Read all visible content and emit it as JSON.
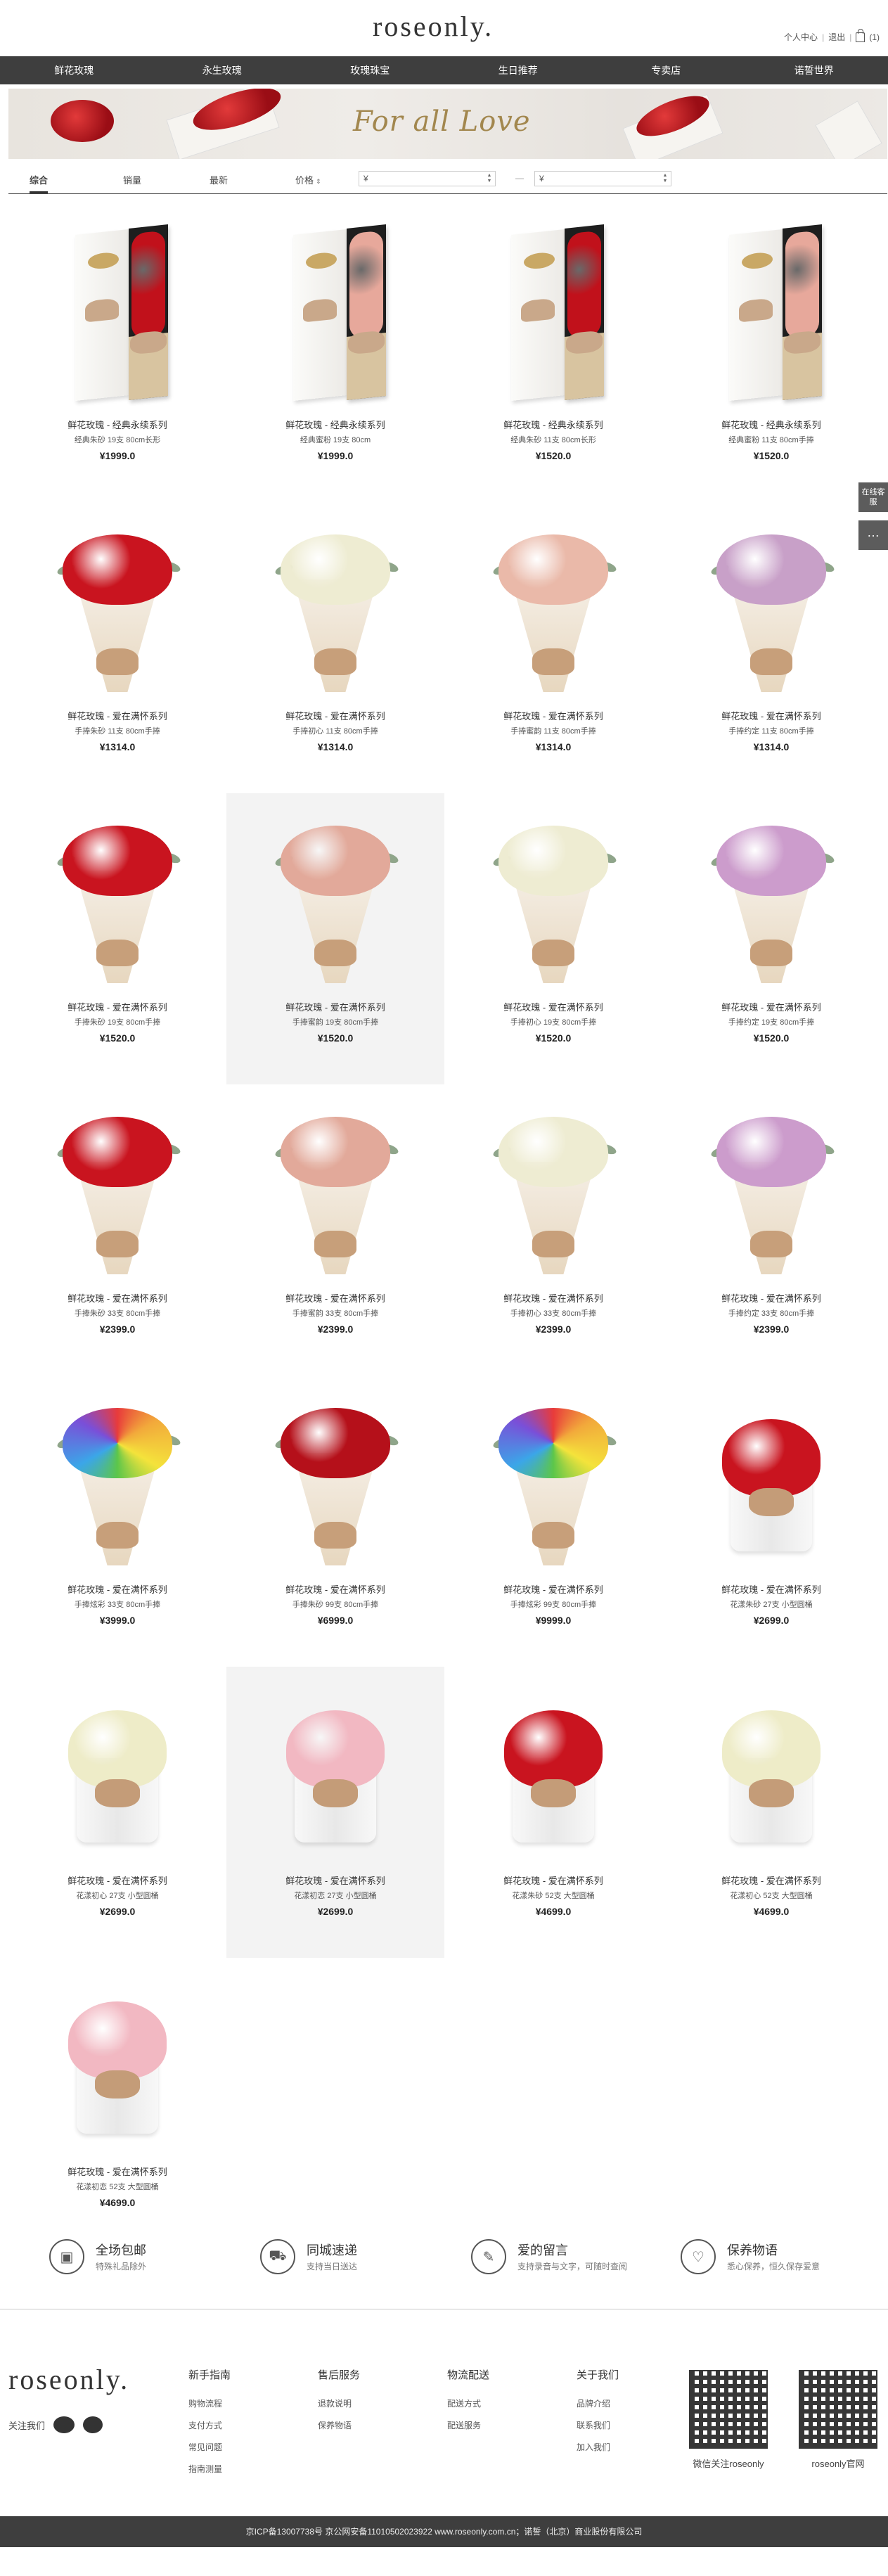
{
  "header": {
    "logo": "roseonly.",
    "user_center": "个人中心",
    "logout": "退出",
    "cart_count": "(1)"
  },
  "nav": [
    {
      "label": "鲜花玫瑰"
    },
    {
      "label": "永生玫瑰"
    },
    {
      "label": "玫瑰珠宝"
    },
    {
      "label": "生日推荐"
    },
    {
      "label": "专卖店"
    },
    {
      "label": "诺誓世界"
    }
  ],
  "banner": {
    "text": "For all Love"
  },
  "sort": {
    "default": "综合",
    "sales": "销量",
    "newest": "最新",
    "price": "价格",
    "price_from": "¥",
    "price_to": "¥",
    "dash": "—"
  },
  "products": [
    {
      "title": "鲜花玫瑰 - 经典永续系列",
      "sub": "经典朱砂 19支 80cm长形",
      "price": "¥1999.0",
      "type": "giftbox",
      "rose_color": "#c1111b"
    },
    {
      "title": "鲜花玫瑰 - 经典永续系列",
      "sub": "经典蜜粉 19支 80cm",
      "price": "¥1999.0",
      "type": "giftbox",
      "rose_color": "#e7a89b"
    },
    {
      "title": "鲜花玫瑰 - 经典永续系列",
      "sub": "经典朱砂 11支 80cm长形",
      "price": "¥1520.0",
      "type": "giftbox",
      "rose_color": "#c1111b"
    },
    {
      "title": "鲜花玫瑰 - 经典永续系列",
      "sub": "经典蜜粉 11支 80cm手捧",
      "price": "¥1520.0",
      "type": "giftbox",
      "rose_color": "#e7a89b"
    },
    {
      "title": "鲜花玫瑰 - 爱在满怀系列",
      "sub": "手捧朱砂 11支 80cm手捧",
      "price": "¥1314.0",
      "type": "bouquet",
      "rose_color": "#c9141f"
    },
    {
      "title": "鲜花玫瑰 - 爱在满怀系列",
      "sub": "手捧初心 11支 80cm手捧",
      "price": "¥1314.0",
      "type": "bouquet",
      "rose_color": "#eeecd2"
    },
    {
      "title": "鲜花玫瑰 - 爱在满怀系列",
      "sub": "手捧蜜韵 11支 80cm手捧",
      "price": "¥1314.0",
      "type": "bouquet",
      "rose_color": "#eab9a9"
    },
    {
      "title": "鲜花玫瑰 - 爱在满怀系列",
      "sub": "手捧约定 11支 80cm手捧",
      "price": "¥1314.0",
      "type": "bouquet",
      "rose_color": "#c8a0c8"
    },
    {
      "title": "鲜花玫瑰 - 爱在满怀系列",
      "sub": "手捧朱砂 19支 80cm手捧",
      "price": "¥1520.0",
      "type": "bouquet",
      "rose_color": "#c9141f"
    },
    {
      "title": "鲜花玫瑰 - 爱在满怀系列",
      "sub": "手捧蜜韵 19支 80cm手捧",
      "price": "¥1520.0",
      "type": "bouquet",
      "rose_color": "#e2a99a"
    },
    {
      "title": "鲜花玫瑰 - 爱在满怀系列",
      "sub": "手捧初心 19支 80cm手捧",
      "price": "¥1520.0",
      "type": "bouquet",
      "rose_color": "#eeecd2"
    },
    {
      "title": "鲜花玫瑰 - 爱在满怀系列",
      "sub": "手捧约定 19支 80cm手捧",
      "price": "¥1520.0",
      "type": "bouquet",
      "rose_color": "#cc9ccc"
    },
    {
      "title": "鲜花玫瑰 - 爱在满怀系列",
      "sub": "手捧朱砂 33支 80cm手捧",
      "price": "¥2399.0",
      "type": "bouquet",
      "rose_color": "#c9141f"
    },
    {
      "title": "鲜花玫瑰 - 爱在满怀系列",
      "sub": "手捧蜜韵 33支 80cm手捧",
      "price": "¥2399.0",
      "type": "bouquet",
      "rose_color": "#e2a99a"
    },
    {
      "title": "鲜花玫瑰 - 爱在满怀系列",
      "sub": "手捧初心 33支 80cm手捧",
      "price": "¥2399.0",
      "type": "bouquet",
      "rose_color": "#eeecd2"
    },
    {
      "title": "鲜花玫瑰 - 爱在满怀系列",
      "sub": "手捧约定 33支 80cm手捧",
      "price": "¥2399.0",
      "type": "bouquet",
      "rose_color": "#cc9ccc"
    },
    {
      "title": "鲜花玫瑰 - 爱在满怀系列",
      "sub": "手捧炫彩 33支 80cm手捧",
      "price": "¥3999.0",
      "type": "bouquet",
      "rose_color": "rainbow"
    },
    {
      "title": "鲜花玫瑰 - 爱在满怀系列",
      "sub": "手捧朱砂 99支 80cm手捧",
      "price": "¥6999.0",
      "type": "bouquet",
      "rose_color": "#b5101a"
    },
    {
      "title": "鲜花玫瑰 - 爱在满怀系列",
      "sub": "手捧炫彩 99支 80cm手捧",
      "price": "¥9999.0",
      "type": "bouquet",
      "rose_color": "rainbow"
    },
    {
      "title": "鲜花玫瑰 - 爱在满怀系列",
      "sub": "花漾朱砂 27支 小型圆桶",
      "price": "¥2699.0",
      "type": "hatbox",
      "rose_color": "#c9141f"
    },
    {
      "title": "鲜花玫瑰 - 爱在满怀系列",
      "sub": "花漾初心 27支 小型圆桶",
      "price": "¥2699.0",
      "type": "hatbox",
      "rose_color": "#eeecc8"
    },
    {
      "title": "鲜花玫瑰 - 爱在满怀系列",
      "sub": "花漾初恋 27支 小型圆桶",
      "price": "¥2699.0",
      "type": "hatbox",
      "rose_color": "#f2b8c2"
    },
    {
      "title": "鲜花玫瑰 - 爱在满怀系列",
      "sub": "花漾朱砂 52支 大型圆桶",
      "price": "¥4699.0",
      "type": "hatbox",
      "rose_color": "#c9141f"
    },
    {
      "title": "鲜花玫瑰 - 爱在满怀系列",
      "sub": "花漾初心 52支 大型圆桶",
      "price": "¥4699.0",
      "type": "hatbox",
      "rose_color": "#eeecc8"
    },
    {
      "title": "鲜花玫瑰 - 爱在满怀系列",
      "sub": "花漾初恋 52支 大型圆桶",
      "price": "¥4699.0",
      "type": "hatbox",
      "rose_color": "#f2b8c2"
    }
  ],
  "float": {
    "service": "在线客服",
    "chat": "…"
  },
  "services": [
    {
      "title": "全场包邮",
      "desc": "特殊礼品除外",
      "icon": "box-icon"
    },
    {
      "title": "同城速递",
      "desc": "支持当日送达",
      "icon": "truck-icon"
    },
    {
      "title": "爱的留言",
      "desc": "支持录音与文字，可随时查阅",
      "icon": "message-icon"
    },
    {
      "title": "保养物语",
      "desc": "悉心保养，恒久保存爱意",
      "icon": "heart-icon"
    }
  ],
  "footer": {
    "logo": "roseonly.",
    "follow": "关注我们",
    "columns": [
      {
        "title": "新手指南",
        "items": [
          "购物流程",
          "支付方式",
          "常见问题",
          "指南测量"
        ]
      },
      {
        "title": "售后服务",
        "items": [
          "退款说明",
          "保养物语"
        ]
      },
      {
        "title": "物流配送",
        "items": [
          "配送方式",
          "配送服务"
        ]
      },
      {
        "title": "关于我们",
        "items": [
          "品牌介绍",
          "联系我们",
          "加入我们"
        ]
      }
    ],
    "qr1_label": "微信关注roseonly",
    "qr2_label": "roseonly官网",
    "icp": "京ICP备13007738号 京公网安备11010502023922 www.roseonly.com.cn；诺誓（北京）商业股份有限公司"
  }
}
